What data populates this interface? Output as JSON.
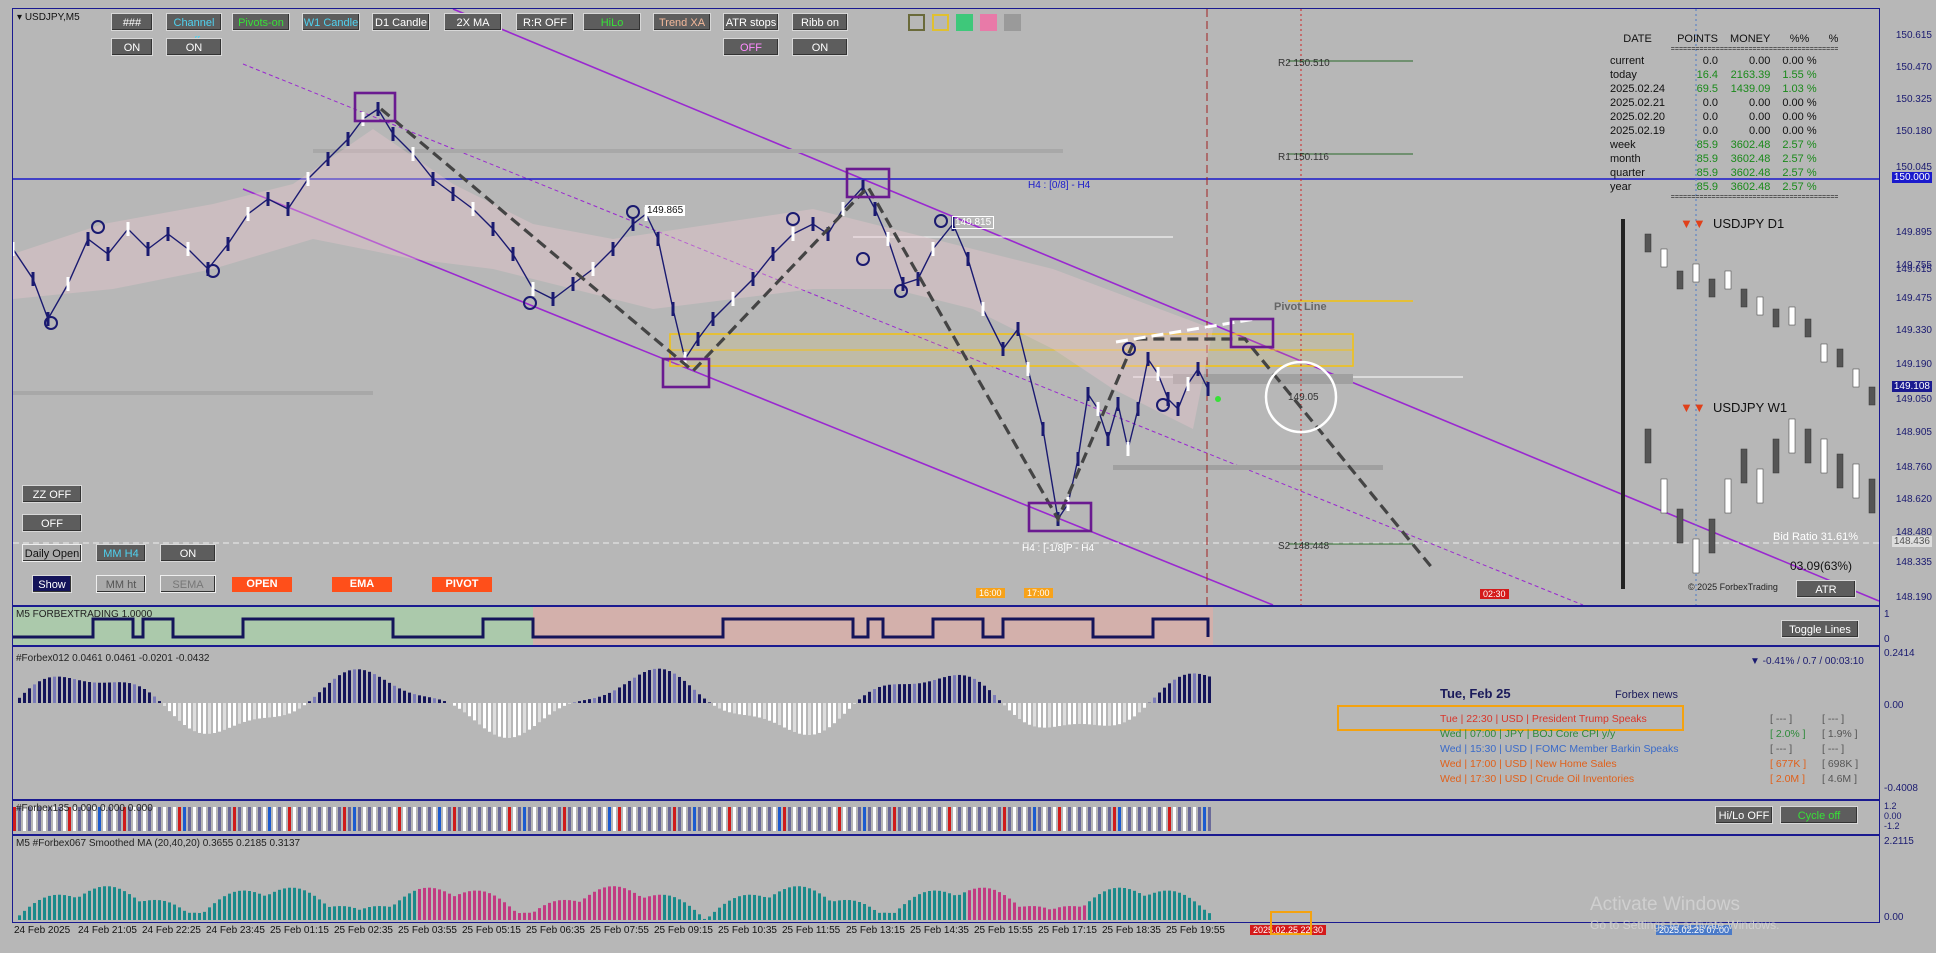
{
  "symbol_header": "USDJPY,M5",
  "toolbar": {
    "row1": [
      {
        "label": "###",
        "style": "white"
      },
      {
        "label": "Channel off",
        "style": "cyan"
      },
      {
        "label": "Pivots-on",
        "style": "green"
      },
      {
        "label": "W1 Candle",
        "style": "cyan"
      },
      {
        "label": "D1 Candle",
        "style": "white"
      },
      {
        "label": "2X MA",
        "style": "white"
      },
      {
        "label": "R:R OFF",
        "style": "white"
      },
      {
        "label": "HiLo",
        "style": "green"
      },
      {
        "label": "Trend XA",
        "style": "tan"
      },
      {
        "label": "ATR stops",
        "style": "white"
      },
      {
        "label": "Ribb on",
        "style": "white"
      }
    ],
    "row2": [
      {
        "label": "ON"
      },
      {
        "label": "ON"
      },
      {
        "label": "OFF"
      },
      {
        "label": "ON"
      }
    ],
    "swatches": [
      "#b7b7b7",
      "#b7b7b7",
      "#3ec87a",
      "#e87aa8",
      "#9a9a9a"
    ]
  },
  "left_panel": {
    "zz_off": "ZZ OFF",
    "off": "OFF",
    "daily_open": "Daily Open",
    "mm_h4": "MM H4",
    "on": "ON",
    "show": "Show",
    "mm_ht": "MM ht",
    "sema": "SEMA",
    "open": "OPEN",
    "ema": "EMA",
    "pivot": "PIVOT"
  },
  "price_axis": [
    "150.615",
    "150.470",
    "150.325",
    "150.180",
    "150.045",
    "150.000",
    "149.895",
    "149.755",
    "149.615",
    "149.475",
    "149.330",
    "149.190",
    "149.108",
    "149.050",
    "148.905",
    "148.760",
    "148.620",
    "148.480",
    "148.436",
    "148.335",
    "148.190"
  ],
  "current_price": "149.108",
  "bid_tag": "148.436",
  "chart_labels": {
    "r2": "R2 150.510",
    "r1": "R1 150.116",
    "s2": "S2 148.448",
    "h4_top": "H4 : [0/8] - H4",
    "h4_bottom": "H4 : [-1/8]P - H4",
    "pivot_line": "Pivot Line",
    "price_149865": "149.865",
    "price_149815": "149.815",
    "price_149050": "149.05",
    "bid_ratio": "Bid Ratio 31.61%",
    "atr_pct": "03.09(63%)",
    "copyright": "© 2025 ForbexTrading",
    "atr_btn": "ATR",
    "time_1600": "16:00",
    "time_1700": "17:00",
    "time_0230": "02:30"
  },
  "performance": {
    "headers": [
      "DATE",
      "POINTS",
      "MONEY",
      "%%",
      "%"
    ],
    "rows": [
      [
        "current",
        "0.0",
        "0.00",
        "0.00 %"
      ],
      [
        "today",
        "16.4",
        "2163.39",
        "1.55 %"
      ],
      [
        " 2025.02.24",
        "69.5",
        "1439.09",
        "1.03 %"
      ],
      [
        " 2025.02.21",
        "0.0",
        "0.00",
        "0.00 %"
      ],
      [
        " 2025.02.20",
        "0.0",
        "0.00",
        "0.00 %"
      ],
      [
        " 2025.02.19",
        "0.0",
        "0.00",
        "0.00 %"
      ],
      [
        "week",
        "85.9",
        "3602.48",
        "2.57 %"
      ],
      [
        " month",
        "85.9",
        "3602.48",
        "2.57 %"
      ],
      [
        "quarter",
        "85.9",
        "3602.48",
        "2.57 %"
      ],
      [
        "year",
        "85.9",
        "3602.48",
        "2.57 %"
      ]
    ]
  },
  "mini_charts": {
    "d1": "USDJPY  D1",
    "w1": "USDJPY  W1"
  },
  "sub1": {
    "title": "M5 FORBEXTRADING 1.0000",
    "toggle": "Toggle Lines",
    "axis": [
      "1",
      "0"
    ]
  },
  "sub2": {
    "title": "#Forbex012 0.0461 0.0461 -0.0201 -0.0432",
    "stat": "▼ -0.41% / 0.7 / 00:03:10",
    "axis": [
      "0.2414",
      "0.00",
      "-0.4008"
    ],
    "news_date": "Tue, Feb 25",
    "news_title": "Forbex news",
    "news": [
      {
        "text": "Tue  |  22:30  |  USD  |  President Trump Speaks",
        "a": "[ --- ]",
        "b": "[ --- ]",
        "color": "#d9362a"
      },
      {
        "text": "Wed  |  07:00  |  JPY  |  BOJ Core CPI y/y",
        "a": "[ 2.0% ]",
        "b": "[ 1.9% ]",
        "color": "#2e8a3a"
      },
      {
        "text": "Wed  |  15:30  |  USD  |  FOMC Member Barkin Speaks",
        "a": "[ --- ]",
        "b": "[ --- ]",
        "color": "#3a6ac8"
      },
      {
        "text": "Wed  |  17:00  |  USD  |  New Home Sales",
        "a": "[ 677K ]",
        "b": "[ 698K ]",
        "color": "#e0601a"
      },
      {
        "text": "Wed  |  17:30  |  USD  |  Crude Oil Inventories",
        "a": "[ 2.0M ]",
        "b": "[ 4.6M ]",
        "color": "#e0601a"
      }
    ]
  },
  "sub3": {
    "title": "#Forbex135 0.000 0.000 0.000",
    "hilo": "Hi/Lo OFF",
    "cycle": "Cycle off",
    "axis": [
      "1.2",
      "0.00",
      "-1.2"
    ]
  },
  "sub4": {
    "title": "M5  #Forbex067 Smoothed MA (20,40,20) 0.3655 0.2185 0.3137",
    "axis": [
      "2.2115",
      "0.00"
    ]
  },
  "time_axis": [
    "24 Feb 2025",
    "24 Feb 21:05",
    "24 Feb 22:25",
    "24 Feb 23:45",
    "25 Feb 01:15",
    "25 Feb 02:35",
    "25 Feb 03:55",
    "25 Feb 05:15",
    "25 Feb 06:35",
    "25 Feb 07:55",
    "25 Feb 09:15",
    "25 Feb 10:35",
    "25 Feb 11:55",
    "25 Feb 13:15",
    "25 Feb 14:35",
    "25 Feb 15:55",
    "25 Feb 17:15",
    "25 Feb 18:35",
    "25 Feb 19:55"
  ],
  "time_tags": {
    "red": "2025.02.25 22:30",
    "blue": "2025.02.26 07:00"
  },
  "watermark": {
    "line1": "Activate Windows",
    "line2": "Go to Settings to activate Windows."
  }
}
